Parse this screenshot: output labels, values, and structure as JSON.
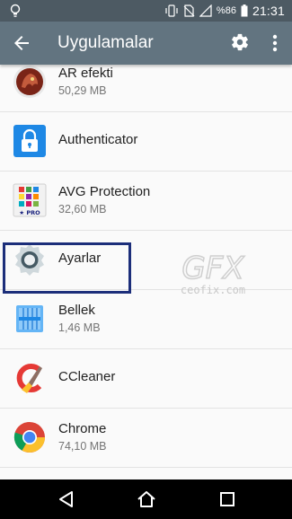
{
  "status_bar": {
    "battery_percent": "%86",
    "time": "21:31"
  },
  "toolbar": {
    "title": "Uygulamalar"
  },
  "apps": [
    {
      "name": "AR efekti",
      "size": "50,29 MB"
    },
    {
      "name": "Authenticator",
      "size": ""
    },
    {
      "name": "AVG Protection",
      "size": "32,60 MB"
    },
    {
      "name": "Ayarlar",
      "size": ""
    },
    {
      "name": "Bellek",
      "size": "1,46 MB"
    },
    {
      "name": "CCleaner",
      "size": ""
    },
    {
      "name": "Chrome",
      "size": "74,10 MB"
    }
  ],
  "watermark": {
    "logo_text": "GFX",
    "url": "ceofix.com"
  },
  "icons": {
    "back": "back-arrow-icon",
    "settings": "gear-icon",
    "more": "more-vert-icon",
    "nav_back": "nav-back-icon",
    "nav_home": "nav-home-icon",
    "nav_recents": "nav-recents-icon"
  },
  "colors": {
    "status_bar": "#4d5a63",
    "toolbar": "#627480",
    "highlight_border": "#1c2e7a"
  }
}
